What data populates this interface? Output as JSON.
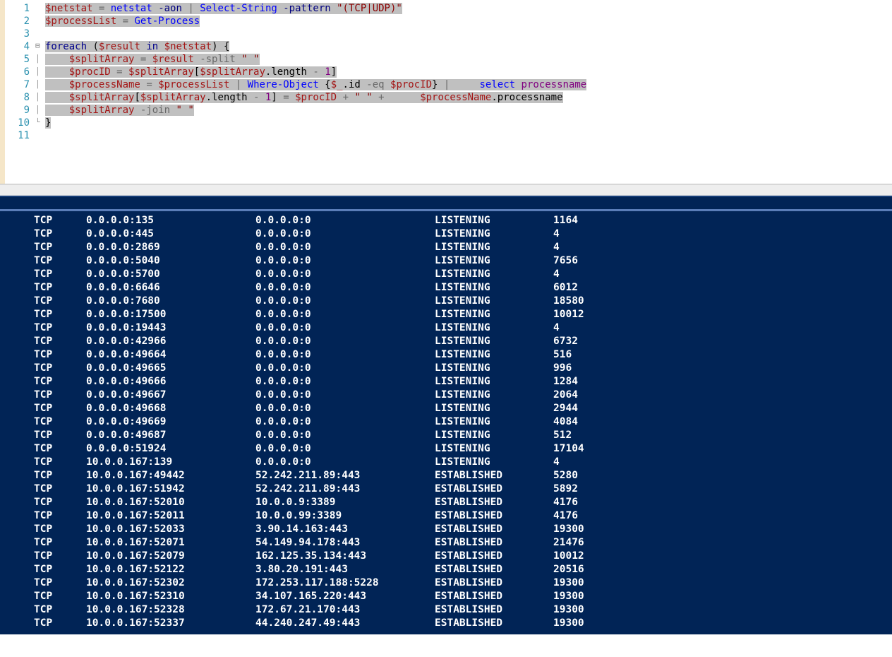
{
  "code_lines": [
    {
      "n": 1,
      "fold": "",
      "segments": [
        {
          "cls": "t-var hl",
          "text": "$netstat"
        },
        {
          "cls": "hl",
          "text": " "
        },
        {
          "cls": "t-op hl",
          "text": "="
        },
        {
          "cls": "hl",
          "text": " "
        },
        {
          "cls": "t-cmd hl",
          "text": "netstat"
        },
        {
          "cls": "hl",
          "text": " "
        },
        {
          "cls": "t-param hl",
          "text": "-aon"
        },
        {
          "cls": "hl",
          "text": " "
        },
        {
          "cls": "t-op hl",
          "text": "|"
        },
        {
          "cls": "hl",
          "text": " "
        },
        {
          "cls": "t-cmd hl",
          "text": "Select-String"
        },
        {
          "cls": "hl",
          "text": " "
        },
        {
          "cls": "t-param hl",
          "text": "-pattern"
        },
        {
          "cls": "hl",
          "text": " "
        },
        {
          "cls": "t-str hl",
          "text": "\"(TCP|UDP)\""
        }
      ]
    },
    {
      "n": 2,
      "fold": "",
      "segments": [
        {
          "cls": "t-var hl",
          "text": "$processList"
        },
        {
          "cls": "hl",
          "text": " "
        },
        {
          "cls": "t-op hl",
          "text": "="
        },
        {
          "cls": "hl",
          "text": " "
        },
        {
          "cls": "t-cmd hl",
          "text": "Get-Process"
        }
      ]
    },
    {
      "n": 3,
      "fold": "",
      "segments": []
    },
    {
      "n": 4,
      "fold": "⊟",
      "segments": [
        {
          "cls": "t-kw hl",
          "text": "foreach"
        },
        {
          "cls": "hl",
          "text": " "
        },
        {
          "cls": "t-punc hl",
          "text": "("
        },
        {
          "cls": "t-var hl",
          "text": "$result"
        },
        {
          "cls": "hl",
          "text": " "
        },
        {
          "cls": "t-kw hl",
          "text": "in"
        },
        {
          "cls": "hl",
          "text": " "
        },
        {
          "cls": "t-var hl",
          "text": "$netstat"
        },
        {
          "cls": "t-punc hl",
          "text": ")"
        },
        {
          "cls": "hl",
          "text": " "
        },
        {
          "cls": "t-punc hl",
          "text": "{"
        }
      ]
    },
    {
      "n": 5,
      "fold": "│",
      "segments": [
        {
          "cls": "hl",
          "text": "    "
        },
        {
          "cls": "t-var hl",
          "text": "$splitArray"
        },
        {
          "cls": "hl",
          "text": " "
        },
        {
          "cls": "t-op hl",
          "text": "="
        },
        {
          "cls": "hl",
          "text": " "
        },
        {
          "cls": "t-var hl",
          "text": "$result"
        },
        {
          "cls": "hl",
          "text": " "
        },
        {
          "cls": "t-op hl",
          "text": "-split"
        },
        {
          "cls": "hl",
          "text": " "
        },
        {
          "cls": "t-str hl",
          "text": "\" \""
        }
      ]
    },
    {
      "n": 6,
      "fold": "│",
      "segments": [
        {
          "cls": "hl",
          "text": "    "
        },
        {
          "cls": "t-var hl",
          "text": "$procID"
        },
        {
          "cls": "hl",
          "text": " "
        },
        {
          "cls": "t-op hl",
          "text": "="
        },
        {
          "cls": "hl",
          "text": " "
        },
        {
          "cls": "t-var hl",
          "text": "$splitArray"
        },
        {
          "cls": "t-punc hl",
          "text": "["
        },
        {
          "cls": "t-var hl",
          "text": "$splitArray"
        },
        {
          "cls": "t-punc hl",
          "text": "."
        },
        {
          "cls": "t-member hl",
          "text": "length"
        },
        {
          "cls": "hl",
          "text": " "
        },
        {
          "cls": "t-op hl",
          "text": "-"
        },
        {
          "cls": "hl",
          "text": " "
        },
        {
          "cls": "t-num hl",
          "text": "1"
        },
        {
          "cls": "t-punc hl",
          "text": "]"
        }
      ]
    },
    {
      "n": 7,
      "fold": "│",
      "segments": [
        {
          "cls": "hl",
          "text": "    "
        },
        {
          "cls": "t-var hl",
          "text": "$processName"
        },
        {
          "cls": "hl",
          "text": " "
        },
        {
          "cls": "t-op hl",
          "text": "="
        },
        {
          "cls": "hl",
          "text": " "
        },
        {
          "cls": "t-var hl",
          "text": "$processList"
        },
        {
          "cls": "hl",
          "text": " "
        },
        {
          "cls": "t-op hl",
          "text": "|"
        },
        {
          "cls": "hl",
          "text": " "
        },
        {
          "cls": "t-cmd hl",
          "text": "Where-Object"
        },
        {
          "cls": "hl",
          "text": " "
        },
        {
          "cls": "t-punc hl",
          "text": "{"
        },
        {
          "cls": "t-var hl",
          "text": "$_"
        },
        {
          "cls": "t-punc hl",
          "text": "."
        },
        {
          "cls": "t-member hl",
          "text": "id"
        },
        {
          "cls": "hl",
          "text": " "
        },
        {
          "cls": "t-op hl",
          "text": "-eq"
        },
        {
          "cls": "hl",
          "text": " "
        },
        {
          "cls": "t-var hl",
          "text": "$procID"
        },
        {
          "cls": "t-punc hl",
          "text": "}"
        },
        {
          "cls": "hl",
          "text": " "
        },
        {
          "cls": "t-op hl",
          "text": "|"
        },
        {
          "cls": "hl",
          "text": "     "
        },
        {
          "cls": "t-cmd hl",
          "text": "select"
        },
        {
          "cls": "hl",
          "text": " "
        },
        {
          "cls": "t-num hl",
          "text": "processname"
        }
      ]
    },
    {
      "n": 8,
      "fold": "│",
      "segments": [
        {
          "cls": "hl",
          "text": "    "
        },
        {
          "cls": "t-var hl",
          "text": "$splitArray"
        },
        {
          "cls": "t-punc hl",
          "text": "["
        },
        {
          "cls": "t-var hl",
          "text": "$splitArray"
        },
        {
          "cls": "t-punc hl",
          "text": "."
        },
        {
          "cls": "t-member hl",
          "text": "length"
        },
        {
          "cls": "hl",
          "text": " "
        },
        {
          "cls": "t-op hl",
          "text": "-"
        },
        {
          "cls": "hl",
          "text": " "
        },
        {
          "cls": "t-num hl",
          "text": "1"
        },
        {
          "cls": "t-punc hl",
          "text": "]"
        },
        {
          "cls": "hl",
          "text": " "
        },
        {
          "cls": "t-op hl",
          "text": "="
        },
        {
          "cls": "hl",
          "text": " "
        },
        {
          "cls": "t-var hl",
          "text": "$procID"
        },
        {
          "cls": "hl",
          "text": " "
        },
        {
          "cls": "t-op hl",
          "text": "+"
        },
        {
          "cls": "hl",
          "text": " "
        },
        {
          "cls": "t-str hl",
          "text": "\" \""
        },
        {
          "cls": "hl",
          "text": " "
        },
        {
          "cls": "t-op hl",
          "text": "+"
        },
        {
          "cls": "hl",
          "text": "      "
        },
        {
          "cls": "t-var hl",
          "text": "$processName"
        },
        {
          "cls": "t-punc hl",
          "text": "."
        },
        {
          "cls": "t-member hl",
          "text": "processname"
        }
      ]
    },
    {
      "n": 9,
      "fold": "│",
      "segments": [
        {
          "cls": "hl",
          "text": "    "
        },
        {
          "cls": "t-var hl",
          "text": "$splitArray"
        },
        {
          "cls": "hl",
          "text": " "
        },
        {
          "cls": "t-op hl",
          "text": "-join"
        },
        {
          "cls": "hl",
          "text": " "
        },
        {
          "cls": "t-str hl",
          "text": "\" \""
        }
      ]
    },
    {
      "n": 10,
      "fold": "└",
      "segments": [
        {
          "cls": "t-punc hl",
          "text": "}"
        }
      ]
    },
    {
      "n": 11,
      "fold": "",
      "segments": []
    }
  ],
  "netstat_rows": [
    {
      "proto": "TCP",
      "local": "0.0.0.0:135",
      "remote": "0.0.0.0:0",
      "state": "LISTENING",
      "pid": "1164"
    },
    {
      "proto": "TCP",
      "local": "0.0.0.0:445",
      "remote": "0.0.0.0:0",
      "state": "LISTENING",
      "pid": "4"
    },
    {
      "proto": "TCP",
      "local": "0.0.0.0:2869",
      "remote": "0.0.0.0:0",
      "state": "LISTENING",
      "pid": "4"
    },
    {
      "proto": "TCP",
      "local": "0.0.0.0:5040",
      "remote": "0.0.0.0:0",
      "state": "LISTENING",
      "pid": "7656"
    },
    {
      "proto": "TCP",
      "local": "0.0.0.0:5700",
      "remote": "0.0.0.0:0",
      "state": "LISTENING",
      "pid": "4"
    },
    {
      "proto": "TCP",
      "local": "0.0.0.0:6646",
      "remote": "0.0.0.0:0",
      "state": "LISTENING",
      "pid": "6012"
    },
    {
      "proto": "TCP",
      "local": "0.0.0.0:7680",
      "remote": "0.0.0.0:0",
      "state": "LISTENING",
      "pid": "18580"
    },
    {
      "proto": "TCP",
      "local": "0.0.0.0:17500",
      "remote": "0.0.0.0:0",
      "state": "LISTENING",
      "pid": "10012"
    },
    {
      "proto": "TCP",
      "local": "0.0.0.0:19443",
      "remote": "0.0.0.0:0",
      "state": "LISTENING",
      "pid": "4"
    },
    {
      "proto": "TCP",
      "local": "0.0.0.0:42966",
      "remote": "0.0.0.0:0",
      "state": "LISTENING",
      "pid": "6732"
    },
    {
      "proto": "TCP",
      "local": "0.0.0.0:49664",
      "remote": "0.0.0.0:0",
      "state": "LISTENING",
      "pid": "516"
    },
    {
      "proto": "TCP",
      "local": "0.0.0.0:49665",
      "remote": "0.0.0.0:0",
      "state": "LISTENING",
      "pid": "996"
    },
    {
      "proto": "TCP",
      "local": "0.0.0.0:49666",
      "remote": "0.0.0.0:0",
      "state": "LISTENING",
      "pid": "1284"
    },
    {
      "proto": "TCP",
      "local": "0.0.0.0:49667",
      "remote": "0.0.0.0:0",
      "state": "LISTENING",
      "pid": "2064"
    },
    {
      "proto": "TCP",
      "local": "0.0.0.0:49668",
      "remote": "0.0.0.0:0",
      "state": "LISTENING",
      "pid": "2944"
    },
    {
      "proto": "TCP",
      "local": "0.0.0.0:49669",
      "remote": "0.0.0.0:0",
      "state": "LISTENING",
      "pid": "4084"
    },
    {
      "proto": "TCP",
      "local": "0.0.0.0:49687",
      "remote": "0.0.0.0:0",
      "state": "LISTENING",
      "pid": "512"
    },
    {
      "proto": "TCP",
      "local": "0.0.0.0:51924",
      "remote": "0.0.0.0:0",
      "state": "LISTENING",
      "pid": "17104"
    },
    {
      "proto": "TCP",
      "local": "10.0.0.167:139",
      "remote": "0.0.0.0:0",
      "state": "LISTENING",
      "pid": "4"
    },
    {
      "proto": "TCP",
      "local": "10.0.0.167:49442",
      "remote": "52.242.211.89:443",
      "state": "ESTABLISHED",
      "pid": "5280"
    },
    {
      "proto": "TCP",
      "local": "10.0.0.167:51942",
      "remote": "52.242.211.89:443",
      "state": "ESTABLISHED",
      "pid": "5892"
    },
    {
      "proto": "TCP",
      "local": "10.0.0.167:52010",
      "remote": "10.0.0.9:3389",
      "state": "ESTABLISHED",
      "pid": "4176"
    },
    {
      "proto": "TCP",
      "local": "10.0.0.167:52011",
      "remote": "10.0.0.99:3389",
      "state": "ESTABLISHED",
      "pid": "4176"
    },
    {
      "proto": "TCP",
      "local": "10.0.0.167:52033",
      "remote": "3.90.14.163:443",
      "state": "ESTABLISHED",
      "pid": "19300"
    },
    {
      "proto": "TCP",
      "local": "10.0.0.167:52071",
      "remote": "54.149.94.178:443",
      "state": "ESTABLISHED",
      "pid": "21476"
    },
    {
      "proto": "TCP",
      "local": "10.0.0.167:52079",
      "remote": "162.125.35.134:443",
      "state": "ESTABLISHED",
      "pid": "10012"
    },
    {
      "proto": "TCP",
      "local": "10.0.0.167:52122",
      "remote": "3.80.20.191:443",
      "state": "ESTABLISHED",
      "pid": "20516"
    },
    {
      "proto": "TCP",
      "local": "10.0.0.167:52302",
      "remote": "172.253.117.188:5228",
      "state": "ESTABLISHED",
      "pid": "19300"
    },
    {
      "proto": "TCP",
      "local": "10.0.0.167:52310",
      "remote": "34.107.165.220:443",
      "state": "ESTABLISHED",
      "pid": "19300"
    },
    {
      "proto": "TCP",
      "local": "10.0.0.167:52328",
      "remote": "172.67.21.170:443",
      "state": "ESTABLISHED",
      "pid": "19300"
    },
    {
      "proto": "TCP",
      "local": "10.0.0.167:52337",
      "remote": "44.240.247.49:443",
      "state": "ESTABLISHED",
      "pid": "19300"
    }
  ]
}
